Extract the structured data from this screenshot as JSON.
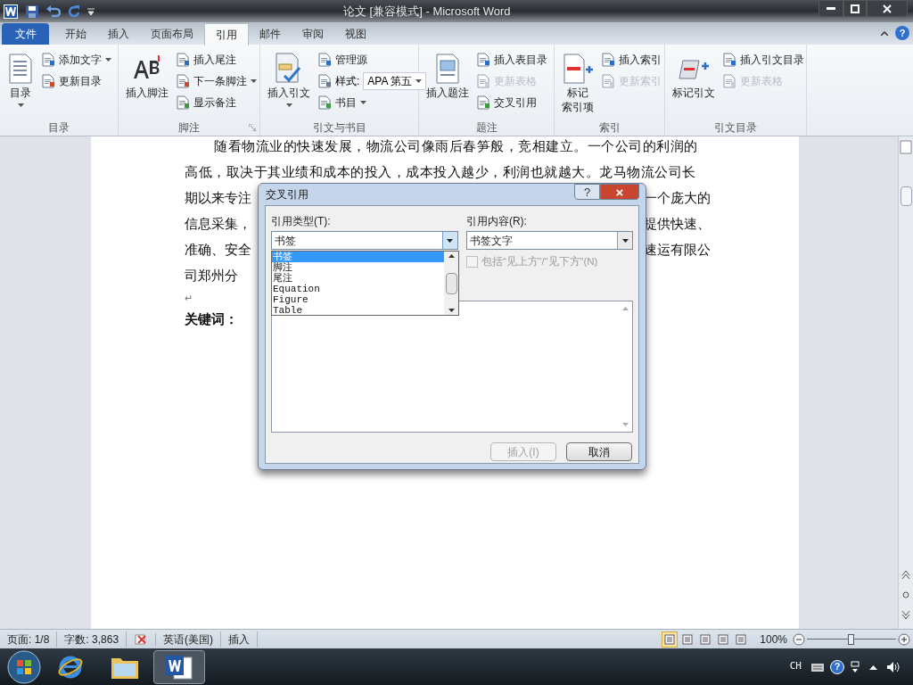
{
  "window": {
    "title": "论文 [兼容模式] - Microsoft Word",
    "help": "?"
  },
  "tabs": [
    {
      "label": "文件",
      "kind": "file",
      "selected": false
    },
    {
      "label": "开始",
      "kind": "tab",
      "selected": false
    },
    {
      "label": "插入",
      "kind": "tab",
      "selected": false
    },
    {
      "label": "页面布局",
      "kind": "tab",
      "selected": false
    },
    {
      "label": "引用",
      "kind": "tab",
      "selected": true
    },
    {
      "label": "邮件",
      "kind": "tab",
      "selected": false
    },
    {
      "label": "审阅",
      "kind": "tab",
      "selected": false
    },
    {
      "label": "视图",
      "kind": "tab",
      "selected": false
    }
  ],
  "ribbon_groups": [
    {
      "label": "目录",
      "launcher": false,
      "items": [
        {
          "kind": "large",
          "lines": [
            "目录"
          ],
          "dropdown": true
        },
        {
          "kind": "small",
          "label": "添加文字",
          "dropdown": true,
          "disabled": false
        },
        {
          "kind": "small",
          "label": "更新目录",
          "dropdown": false,
          "disabled": false
        }
      ]
    },
    {
      "label": "脚注",
      "launcher": true,
      "items": [
        {
          "kind": "large",
          "lines": [
            "插入脚注"
          ],
          "dropdown": false
        },
        {
          "kind": "small",
          "label": "插入尾注",
          "dropdown": false,
          "disabled": false
        },
        {
          "kind": "small",
          "label": "下一条脚注",
          "dropdown": true,
          "disabled": false
        },
        {
          "kind": "small",
          "label": "显示备注",
          "dropdown": false,
          "disabled": false
        }
      ]
    },
    {
      "label": "引文与书目",
      "launcher": false,
      "items": [
        {
          "kind": "large",
          "lines": [
            "插入引文"
          ],
          "dropdown": true
        },
        {
          "kind": "small",
          "label": "管理源",
          "dropdown": false,
          "disabled": false
        },
        {
          "kind": "style",
          "label": "样式:",
          "value": "APA 第五"
        },
        {
          "kind": "small",
          "label": "书目",
          "dropdown": true,
          "disabled": false
        }
      ]
    },
    {
      "label": "题注",
      "launcher": false,
      "items": [
        {
          "kind": "large",
          "lines": [
            "插入题注"
          ],
          "dropdown": false
        },
        {
          "kind": "small",
          "label": "插入表目录",
          "dropdown": false,
          "disabled": false
        },
        {
          "kind": "small",
          "label": "更新表格",
          "dropdown": false,
          "disabled": true
        },
        {
          "kind": "small",
          "label": "交叉引用",
          "dropdown": false,
          "disabled": false
        }
      ]
    },
    {
      "label": "索引",
      "launcher": false,
      "items": [
        {
          "kind": "large",
          "lines": [
            "标记",
            "索引项"
          ],
          "dropdown": false
        },
        {
          "kind": "small",
          "label": "插入索引",
          "dropdown": false,
          "disabled": false
        },
        {
          "kind": "small",
          "label": "更新索引",
          "dropdown": false,
          "disabled": true
        }
      ]
    },
    {
      "label": "引文目录",
      "launcher": false,
      "items": [
        {
          "kind": "large",
          "lines": [
            "标记引文"
          ],
          "dropdown": false
        },
        {
          "kind": "small",
          "label": "插入引文目录",
          "dropdown": false,
          "disabled": false
        },
        {
          "kind": "small",
          "label": "更新表格",
          "dropdown": false,
          "disabled": true
        }
      ]
    }
  ],
  "document": {
    "lines": [
      {
        "kind": "indent",
        "left": "随看物流业的快速发展，物流公司像雨后春笋般，竞相建立。一个公司的利润的"
      },
      {
        "kind": "full",
        "left": "高低，取决于其业绩和成本的投入，成本投入越少，利润也就越大。龙马物流公司长"
      },
      {
        "kind": "split",
        "left": "期以来专注",
        "right": "一个庞大的"
      },
      {
        "kind": "split",
        "left": "信息采集，",
        "right": "提供快速、"
      },
      {
        "kind": "split",
        "left": "准确、安全",
        "right": "速运有限公"
      },
      {
        "kind": "split",
        "left": "司郑州分"
      },
      {
        "kind": "mark",
        "left": "↵"
      },
      {
        "kind": "bold",
        "left": "关键词："
      }
    ]
  },
  "dialog": {
    "title": "交叉引用",
    "help": "?",
    "close": "×",
    "type_label": "引用类型(T):",
    "type_value": "书签",
    "type_options": [
      {
        "label": "书签",
        "selected": true
      },
      {
        "label": "脚注",
        "selected": false
      },
      {
        "label": "尾注",
        "selected": false
      },
      {
        "label": "Equation",
        "selected": false
      },
      {
        "label": "Figure",
        "selected": false
      },
      {
        "label": "Table",
        "selected": false
      }
    ],
    "content_label": "引用内容(R):",
    "content_value": "书签文字",
    "checkbox": {
      "label": "包括“见上方”/“见下方”(N)",
      "checked": false,
      "disabled": true
    },
    "buttons": [
      {
        "label": "插入(I)",
        "disabled": true
      },
      {
        "label": "取消",
        "disabled": false
      }
    ]
  },
  "status_bar": {
    "items": [
      {
        "kind": "text",
        "label": "页面: 1/8"
      },
      {
        "kind": "text",
        "label": "字数: 3,863"
      },
      {
        "kind": "icon"
      },
      {
        "kind": "text",
        "label": "英语(美国)"
      },
      {
        "kind": "text",
        "label": "插入"
      }
    ],
    "views": [
      {
        "selected": true
      },
      {
        "selected": false
      },
      {
        "selected": false
      },
      {
        "selected": false
      },
      {
        "selected": false
      }
    ],
    "zoom": "100%",
    "zoom_level": {
      "level": 0.5
    }
  },
  "taskbar": {
    "apps": [
      {
        "kind": "ie",
        "selected": false
      },
      {
        "kind": "folder",
        "selected": false
      },
      {
        "kind": "word",
        "selected": true
      }
    ],
    "language": "CH",
    "help": "?"
  }
}
